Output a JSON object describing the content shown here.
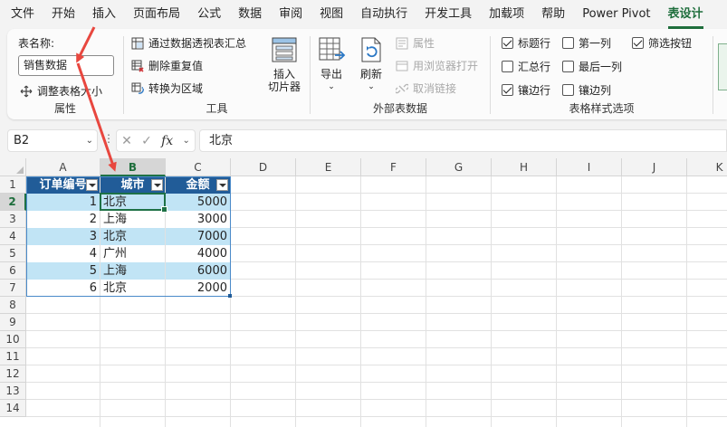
{
  "menu": {
    "tabs": [
      "文件",
      "开始",
      "插入",
      "页面布局",
      "公式",
      "数据",
      "审阅",
      "视图",
      "自动执行",
      "开发工具",
      "加载项",
      "帮助",
      "Power Pivot",
      "表设计"
    ],
    "active": "表设计"
  },
  "ribbon": {
    "properties": {
      "table_name_label": "表名称:",
      "table_name_value": "销售数据",
      "resize_label": "调整表格大小",
      "group_title": "属性"
    },
    "tools": {
      "pivot_label": "通过数据透视表汇总",
      "remove_dup_label": "删除重复值",
      "convert_label": "转换为区域",
      "slicer_label_1": "插入",
      "slicer_label_2": "切片器",
      "group_title": "工具"
    },
    "external": {
      "export_label": "导出",
      "refresh_label": "刷新",
      "properties_label": "属性",
      "open_browser_label": "用浏览器打开",
      "unlink_label": "取消链接",
      "group_title": "外部表数据"
    },
    "style_options": {
      "header_row": "标题行",
      "first_column": "第一列",
      "filter_button": "筛选按钮",
      "total_row": "汇总行",
      "last_column": "最后一列",
      "banded_rows": "镶边行",
      "banded_columns": "镶边列",
      "group_title": "表格样式选项"
    }
  },
  "formula_bar": {
    "name_box": "B2",
    "fx": "fx",
    "content": "北京"
  },
  "grid": {
    "columns": [
      "A",
      "B",
      "C",
      "D",
      "E",
      "F",
      "G",
      "H",
      "I",
      "J",
      "K"
    ],
    "rows": [
      "1",
      "2",
      "3",
      "4",
      "5",
      "6",
      "7",
      "8",
      "9",
      "10",
      "11",
      "12",
      "13",
      "14"
    ],
    "selected_column": "B",
    "selected_row": "2"
  },
  "table": {
    "headers": [
      "订单编号",
      "城市",
      "金额"
    ],
    "rows": [
      [
        "1",
        "北京",
        "5000"
      ],
      [
        "2",
        "上海",
        "3000"
      ],
      [
        "3",
        "北京",
        "7000"
      ],
      [
        "4",
        "广州",
        "4000"
      ],
      [
        "5",
        "上海",
        "6000"
      ],
      [
        "6",
        "北京",
        "2000"
      ]
    ]
  },
  "colors": {
    "accent": "#1e6e3c",
    "table_header": "#215c98",
    "band": "#c1e4f5",
    "arrow": "#e8473f"
  }
}
